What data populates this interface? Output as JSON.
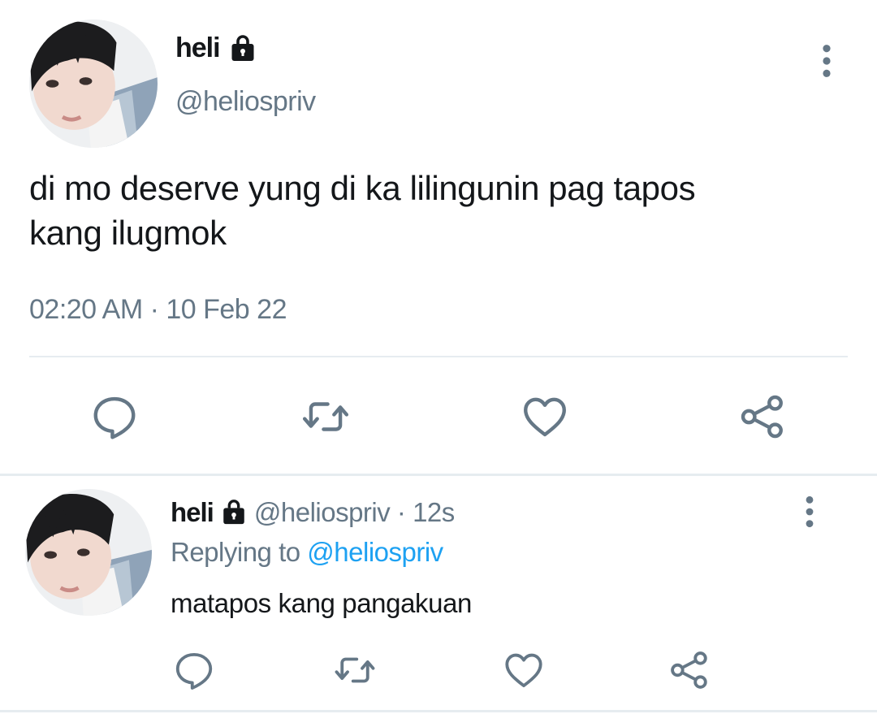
{
  "main_tweet": {
    "display_name": "heli",
    "handle": "@heliospriv",
    "text_line1": "di mo deserve yung di ka lilingunin pag tapos",
    "text_line2": "kang ilugmok",
    "timestamp": "02:20 AM · 10 Feb 22",
    "icons": {
      "lock": "lock-icon",
      "more": "more-vertical-icon",
      "reply": "reply-icon",
      "retweet": "retweet-icon",
      "like": "heart-icon",
      "share": "share-icon"
    }
  },
  "reply_tweet": {
    "display_name": "heli",
    "handle_time": "@heliospriv · 12s",
    "replying_prefix": "Replying to",
    "replying_handle": "@heliospriv",
    "text": "matapos kang pangakuan"
  },
  "colors": {
    "text": "#14171a",
    "secondary": "#657786",
    "link": "#1da1f2",
    "divider": "#e6ecf0",
    "icon": "#657786"
  }
}
